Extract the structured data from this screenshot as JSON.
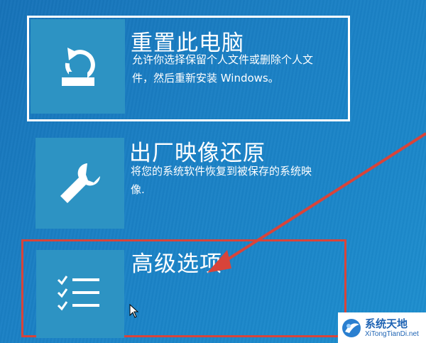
{
  "options": {
    "reset": {
      "title": "重置此电脑",
      "desc_line1": "允许你选择保留个人文件或删除个人文",
      "desc_line2": "件，然后重新安装 Windows。",
      "icon": "reset-icon"
    },
    "image": {
      "title": "出厂映像还原",
      "desc_line1": "将您的系统软件恢复到被保存的系统映",
      "desc_line2": "像.",
      "icon": "wrench-icon"
    },
    "advanced": {
      "title": "高级选项",
      "icon": "checklist-icon"
    }
  },
  "annotation": {
    "arrow_color": "#d8443a",
    "box_color": "#d8443a"
  },
  "watermark": {
    "cn": "系统天地",
    "en": "XiTongTianDi.net"
  },
  "colors": {
    "background": "#1a7fc4",
    "tile": "#2d93c3"
  }
}
